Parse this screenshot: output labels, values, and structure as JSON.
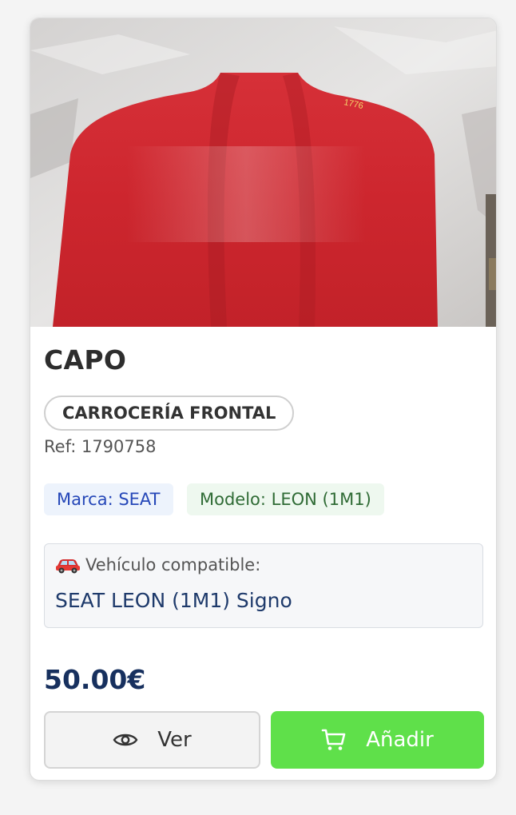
{
  "product": {
    "title": "CAPO",
    "category": "CARROCERÍA FRONTAL",
    "ref": "Ref: 1790758",
    "brand_tag": "Marca: SEAT",
    "model_tag": "Modelo: LEON (1M1)",
    "compat_label": "Vehículo compatible:",
    "compat_icon": "car-icon",
    "compat_value": "SEAT LEON (1M1) Signo",
    "price": "50.00€",
    "photo_marking": "1776"
  },
  "actions": {
    "view_label": "Ver",
    "view_icon": "eye-icon",
    "add_label": "Añadir",
    "add_icon": "cart-icon"
  },
  "colors": {
    "add_button": "#5fe04a",
    "price": "#17305e",
    "brand_tag_text": "#2547b8",
    "model_tag_text": "#2f6b35"
  }
}
